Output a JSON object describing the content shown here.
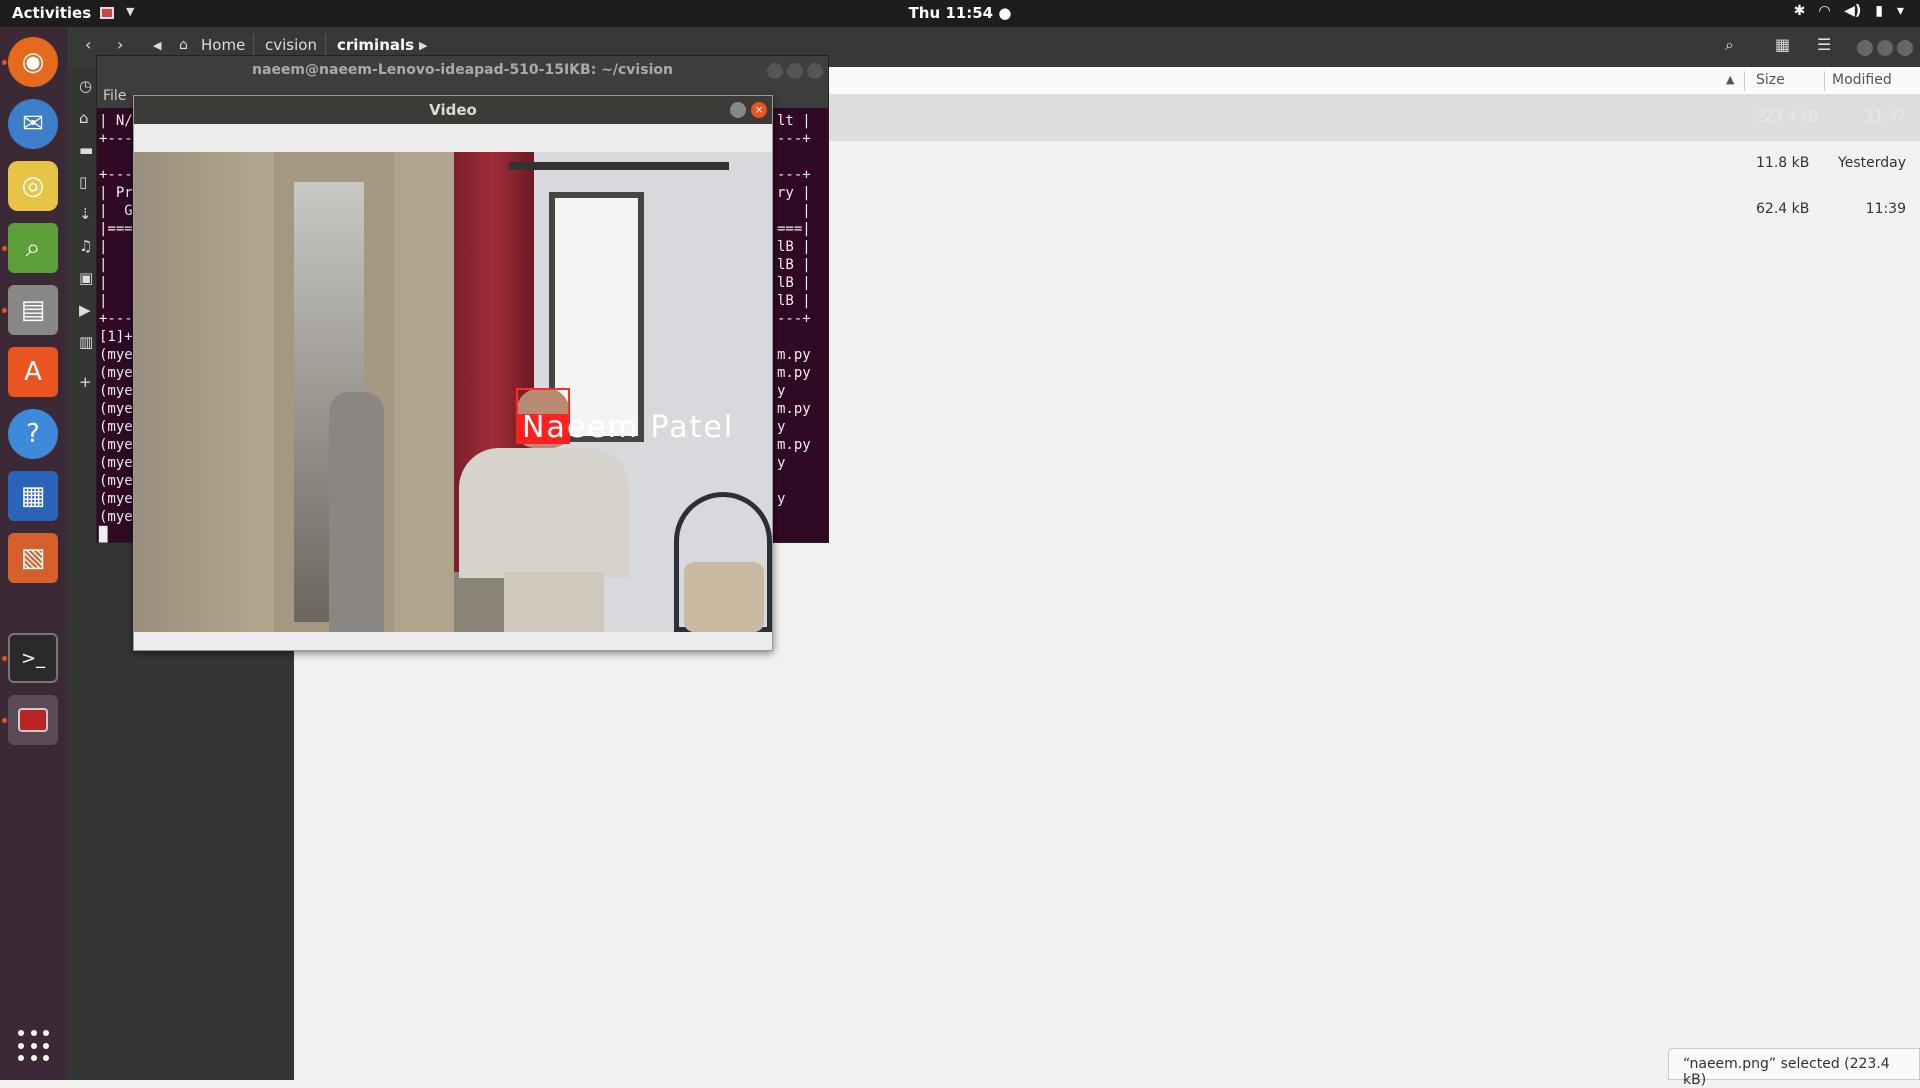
{
  "topbar": {
    "activities": "Activities",
    "clock": "Thu 11:54 ●"
  },
  "dock": {
    "items": [
      {
        "name": "firefox"
      },
      {
        "name": "thunderbird"
      },
      {
        "name": "rhythmbox"
      },
      {
        "name": "image-viewer"
      },
      {
        "name": "files"
      },
      {
        "name": "ubuntu-software"
      },
      {
        "name": "help"
      },
      {
        "name": "libreoffice-writer"
      },
      {
        "name": "libreoffice-impress"
      },
      {
        "name": "terminal"
      },
      {
        "name": "video-app"
      }
    ]
  },
  "file_manager": {
    "breadcrumbs": [
      "Home",
      "cvision",
      "criminals"
    ],
    "columns": {
      "size": "Size",
      "modified": "Modified"
    },
    "rows": [
      {
        "size": "223.4 kB",
        "modified": "11:47",
        "selected": true
      },
      {
        "size": "11.8 kB",
        "modified": "Yesterday",
        "selected": false
      },
      {
        "size": "62.4 kB",
        "modified": "11:39",
        "selected": false
      }
    ],
    "status": "“naeem.png” selected (223.4 kB)"
  },
  "terminal": {
    "title": "naeem@naeem-Lenovo-ideapad-510-15IKB: ~/cvision",
    "menu": "File",
    "left_lines": "| N/\n+---\n\n+---\n| Pr\n|  G\n|===\n|\n|\n|\n|\n+---\n[1]+\n(mye\n(mye\n(mye\n(mye\n(mye\n(mye\n(mye\n(mye\n(mye\n(mye\n█",
    "right_lines": "lt |\n---+\n\n---+\nry |\n   |\n===|\nlB |\nlB |\nlB |\nlB |\n---+\n\nm.py\nm.py\ny\nm.py\ny\nm.py\ny\n\ny"
  },
  "video_window": {
    "title": "Video",
    "face_label": "Naeem Patel"
  }
}
